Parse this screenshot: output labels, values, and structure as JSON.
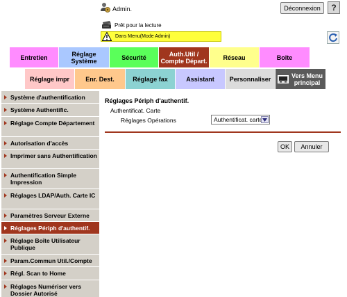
{
  "header": {
    "user_label": "Admin.",
    "logout_label": "Déconnexion",
    "help_label": "?",
    "status_text": "Prêt pour la lecture",
    "mode_text": "Dans Menu(Mode Admin)"
  },
  "tabs": {
    "row1": [
      {
        "label": "Entretien",
        "color": "#ff8cff"
      },
      {
        "label": "Réglage Système",
        "color": "#aac8ff"
      },
      {
        "label": "Sécurité",
        "color": "#5aff5a"
      },
      {
        "label": "Auth.Util / Compte Départ.",
        "color": "#a0361e"
      },
      {
        "label": "Réseau",
        "color": "#ffff8c"
      },
      {
        "label": "Boîte",
        "color": "#ff8cff"
      }
    ],
    "row2": [
      {
        "label": "Réglage impr",
        "color": "#ffc8c8"
      },
      {
        "label": "Enr. Dest.",
        "color": "#ffc88c"
      },
      {
        "label": "Réglage fax",
        "color": "#8cd2d2"
      },
      {
        "label": "Assistant",
        "color": "#c8c8ff"
      },
      {
        "label": "Personnaliser",
        "color": "#dcdcdc"
      },
      {
        "label": "Vers Menu principal",
        "color": "#5a5a5a"
      }
    ]
  },
  "sidebar": {
    "items": [
      {
        "label": "Système d'authentification"
      },
      {
        "label": "Système Authentific."
      },
      {
        "label": "Réglage Compte Département"
      },
      {
        "label": "Autorisation d'accès"
      },
      {
        "label": "Imprimer sans Authentification"
      },
      {
        "label": "Authentification Simple Impression"
      },
      {
        "label": "Réglages LDAP/Auth. Carte IC"
      },
      {
        "label": "Paramètres Serveur Externe"
      },
      {
        "label": "Réglages Périph d'authentif."
      },
      {
        "label": "Réglage Boîte Utilisateur Publique"
      },
      {
        "label": "Param.Commun Util./Compte"
      },
      {
        "label": "Régl. Scan to Home"
      },
      {
        "label": "Réglages Numériser vers Dossier Autorisé"
      }
    ],
    "active_index": 8
  },
  "main": {
    "title": "Réglages Périph d'authentif.",
    "section_label": "Authentificat. Carte",
    "operation_label": "Réglages Opérations",
    "operation_value": "Authentificat. carte",
    "ok_label": "OK",
    "cancel_label": "Annuler"
  },
  "colors": {
    "accent": "#a0361e",
    "sidebar_bg": "#d4d0c8",
    "mode_banner": "#ffff3c"
  }
}
